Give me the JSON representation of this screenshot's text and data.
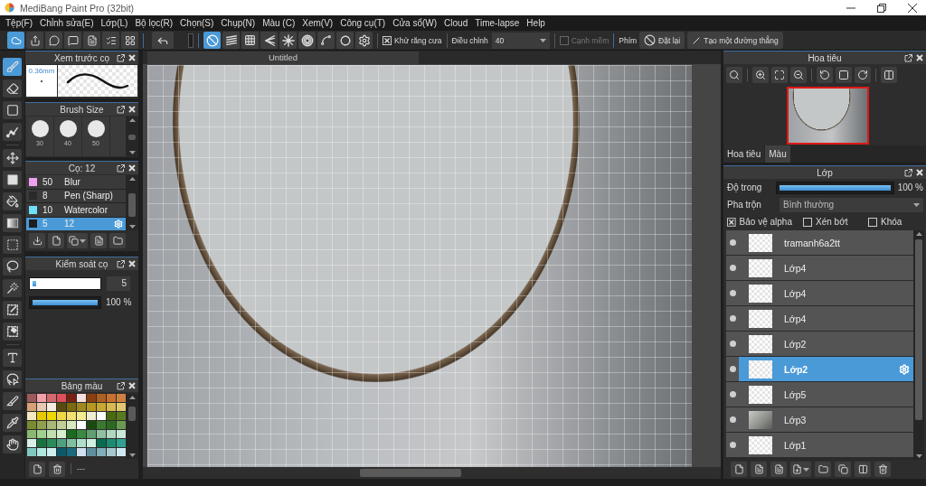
{
  "window": {
    "title": "MediBang Paint Pro (32bit)"
  },
  "menu": [
    "Tệp(F)",
    "Chỉnh sửa(E)",
    "Lớp(L)",
    "Bộ lọc(R)",
    "Chọn(S)",
    "Chụp(N)",
    "Màu (C)",
    "Xem(V)",
    "Công cụ(T)",
    "Cửa sổ(W)",
    "Cloud",
    "Time-lapse",
    "Help"
  ],
  "toolbar": {
    "actions": [
      {
        "selected": true
      },
      {
        "selected": false
      },
      {
        "selected": false
      },
      {
        "selected": false
      },
      {
        "selected": false
      },
      {
        "selected": false
      },
      {
        "selected": false
      }
    ],
    "guides": [
      {
        "selected": true
      },
      {
        "selected": false
      },
      {
        "selected": false
      },
      {
        "selected": false
      },
      {
        "selected": false
      },
      {
        "selected": false
      },
      {
        "selected": false
      },
      {
        "selected": false
      },
      {
        "selected": false
      }
    ],
    "antialias": {
      "label": "Khử răng cưa",
      "checked": true
    },
    "adjust": {
      "label": "Điều chỉnh",
      "value": "40"
    },
    "soft_edge": {
      "label": "Cạnh mềm",
      "checked": false,
      "disabled": true
    },
    "keys": {
      "label": "Phím",
      "buttons": [
        "Đặt lại",
        "Tạo một đường thẳng"
      ]
    }
  },
  "tools": [
    {
      "selected": true
    },
    {
      "selected": false
    },
    {
      "selected": false
    },
    {
      "selected": false
    },
    {
      "selected": false
    },
    {
      "selected": false
    },
    {
      "selected": false
    },
    {
      "selected": false
    },
    {
      "selected": false
    },
    {
      "selected": false
    },
    {
      "selected": false
    },
    {
      "selected": false
    },
    {
      "selected": false
    },
    {
      "selected": false
    },
    {
      "selected": false
    },
    {
      "selected": false
    },
    {
      "selected": false
    },
    {
      "selected": false
    }
  ],
  "brush_preview": {
    "title": "Xem trước cọ",
    "size": "0.36mm"
  },
  "brush_size": {
    "title": "Brush Size",
    "sizes": [
      "30",
      "40",
      "50"
    ]
  },
  "brushes": {
    "title": "Cọ: 12",
    "items": [
      {
        "color": "#f0a0f0",
        "size": "50",
        "name": "Blur",
        "selected": false
      },
      {
        "color": "#2a2a2a",
        "size": "8",
        "name": "Pen (Sharp)",
        "selected": false
      },
      {
        "color": "#70e0f8",
        "size": "10",
        "name": "Watercolor",
        "selected": false
      },
      {
        "color": "#1e1e1e",
        "size": "5",
        "name": "12",
        "selected": true
      }
    ]
  },
  "brush_control": {
    "title": "Kiểm soát cọ",
    "sliders": [
      {
        "kind": "field",
        "level": 0.05,
        "reading": "5"
      },
      {
        "kind": "text",
        "level": 1,
        "reading": "100 %"
      }
    ]
  },
  "palette": {
    "title": "Bảng màu",
    "footer": "---",
    "colors": [
      {
        "color": "#9c5a5a"
      },
      {
        "color": "#f4a0a8"
      },
      {
        "color": "#d46a70"
      },
      {
        "color": "#e05058"
      },
      {
        "color": "#7a2010"
      },
      {
        "color": "#f6e0e0"
      },
      {
        "color": "#8a4010"
      },
      {
        "color": "#b06020"
      },
      {
        "color": "#c87030"
      },
      {
        "color": "#d08040"
      },
      {
        "color": "#d8a078"
      },
      {
        "color": "#e8c8b0"
      },
      {
        "color": "#f4ece0"
      },
      {
        "color": "#5a4a10"
      },
      {
        "color": "#7a6a10"
      },
      {
        "color": "#a08820"
      },
      {
        "color": "#b89820"
      },
      {
        "color": "#c8a830"
      },
      {
        "color": "#d8b850"
      },
      {
        "color": "#e0c870"
      },
      {
        "color": "#f4e8c0"
      },
      {
        "color": "#e8c800"
      },
      {
        "color": "#f0d800"
      },
      {
        "color": "#f0d840"
      },
      {
        "color": "#f4e070"
      },
      {
        "color": "#f4ec90"
      },
      {
        "color": "#f0ecd0"
      },
      {
        "color": "#ffffff"
      },
      {
        "color": "#4a6a10"
      },
      {
        "color": "#5a7a20"
      },
      {
        "color": "#7a8a30"
      },
      {
        "color": "#90a050"
      },
      {
        "color": "#a8b878"
      },
      {
        "color": "#c0d098"
      },
      {
        "color": "#d8e8c0"
      },
      {
        "color": "#ffffff"
      },
      {
        "color": "#1a4a10"
      },
      {
        "color": "#3a7a30"
      },
      {
        "color": "#2a6a20"
      },
      {
        "color": "#6a9a50"
      },
      {
        "color": "#8ab870"
      },
      {
        "color": "#a0d090"
      },
      {
        "color": "#c0e0b0"
      },
      {
        "color": "#d8f0d0"
      },
      {
        "color": "#1a6a20"
      },
      {
        "color": "#3a8a40"
      },
      {
        "color": "#60a070"
      },
      {
        "color": "#90c0a0"
      },
      {
        "color": "#b0d8c0"
      },
      {
        "color": "#c8e8d8"
      },
      {
        "color": "#d8f0e8"
      },
      {
        "color": "#1a7040"
      },
      {
        "color": "#2a8a5a"
      },
      {
        "color": "#50a080"
      },
      {
        "color": "#80c0a0"
      },
      {
        "color": "#b0e0c8"
      },
      {
        "color": "#d0f0e0"
      },
      {
        "color": "#0a6a50"
      },
      {
        "color": "#1a8a70"
      },
      {
        "color": "#30a090"
      },
      {
        "color": "#80c8c0"
      },
      {
        "color": "#b0e8e0"
      },
      {
        "color": "#d0f0f0"
      },
      {
        "color": "#0a5a6a"
      },
      {
        "color": "#1a6a80"
      },
      {
        "color": "#d0e0f0"
      },
      {
        "color": "#6090a0"
      },
      {
        "color": "#80b0b8"
      },
      {
        "color": "#a8c8d0"
      },
      {
        "color": "#d0e8f0"
      }
    ]
  },
  "canvas": {
    "tab": "Untitled"
  },
  "navigator": {
    "title": "Hoa tiêu",
    "tabs": [
      {
        "label": "Hoa tiêu",
        "selected": true
      },
      {
        "label": "Màu",
        "selected": false
      }
    ]
  },
  "layers": {
    "title": "Lớp",
    "opacity": {
      "label": "Độ trong",
      "level": 1,
      "reading": "100 %"
    },
    "blend": {
      "label": "Pha trộn",
      "value": "Bình thường"
    },
    "options": [
      {
        "label": "Bảo vệ alpha",
        "checked": true
      },
      {
        "label": "Xén bớt",
        "checked": false
      },
      {
        "label": "Khóa",
        "checked": false
      }
    ],
    "items": [
      {
        "name": "tramanh6a2tt",
        "kind": "blank",
        "visible": true,
        "selected": false
      },
      {
        "name": "Lớp4",
        "kind": "blank",
        "visible": true,
        "selected": false
      },
      {
        "name": "Lớp4",
        "kind": "blank",
        "visible": true,
        "selected": false
      },
      {
        "name": "Lớp4",
        "kind": "blank",
        "visible": true,
        "selected": false
      },
      {
        "name": "Lớp2",
        "kind": "blank",
        "visible": true,
        "selected": false
      },
      {
        "name": "Lớp2",
        "kind": "blank",
        "visible": true,
        "selected": true
      },
      {
        "name": "Lớp5",
        "kind": "blank",
        "visible": true,
        "selected": false
      },
      {
        "name": "Lớp3",
        "kind": "photo",
        "visible": true,
        "selected": false
      },
      {
        "name": "Lớp1",
        "kind": "blank",
        "visible": true,
        "selected": false
      }
    ]
  }
}
